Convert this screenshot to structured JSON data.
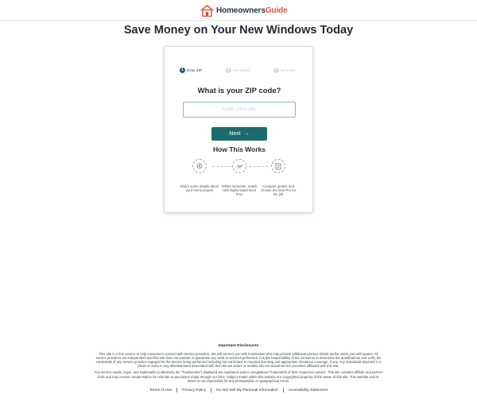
{
  "header": {
    "logo_brand_main": "Homeowners",
    "logo_brand_accent": "Guide",
    "logo_icon": "house-icon",
    "accent_color": "#e0543c"
  },
  "headline": "Save Money on Your New Windows Today",
  "steps": [
    {
      "number": "1",
      "label": "Enter ZIP",
      "state": "active"
    },
    {
      "number": "2",
      "label": "Get Details",
      "state": "inactive"
    },
    {
      "number": "3",
      "label": "Schedule",
      "state": "inactive"
    }
  ],
  "form": {
    "question": "What is your ZIP code?",
    "zip_value": "",
    "zip_placeholder": "Enter ZIP Code",
    "next_label": "Next",
    "next_icon": "arrow-right-icon",
    "button_color": "#1c6b6e"
  },
  "how_it_works": {
    "title": "How This Works",
    "steps": [
      {
        "icon": "details-icon",
        "text": "Share some details about your home project"
      },
      {
        "icon": "handshake-icon",
        "text": "Within moments, match with highly-rated local Pros"
      },
      {
        "icon": "quote-icon",
        "text": "Compare quotes and choose the best Pro for the job"
      }
    ]
  },
  "disclosures": {
    "title": "Important Disclosures",
    "paragraph_1": "This site is a free service to help consumers connect with service providers. We will connect you with businesses who may provide additional product details and/or assist you with quotes. All service providers are independent and this site does not warrant or guarantee any work or services performed. It is the responsibility of the consumer to determine the qualifications and verify the credentials of any service provider engaged for the service being performed including but not limited to required licensing and appropriate insurance coverage, if any. Any individuals depicted in a photo or video in any advertisement associated with this site are actors or models and not actual service providers affiliated with this site.",
    "paragraph_2": "Any service marks, logos, and trademarks (collectively the \"Trademarks\") displayed are registered and/or unregistered Trademarks of their respective owners. This site contains affiliate and partner links and may receive compensation for referrals or purchases made through our links. Subject matter within this website are copyrighted property of the owner of this site. This website and its owner is not responsible for any photographic or typographical errors."
  },
  "footer": {
    "links": [
      "Terms of Use",
      "Privacy Policy",
      "Do Not Sell My Personal Information",
      "Accessibility Statement"
    ]
  }
}
